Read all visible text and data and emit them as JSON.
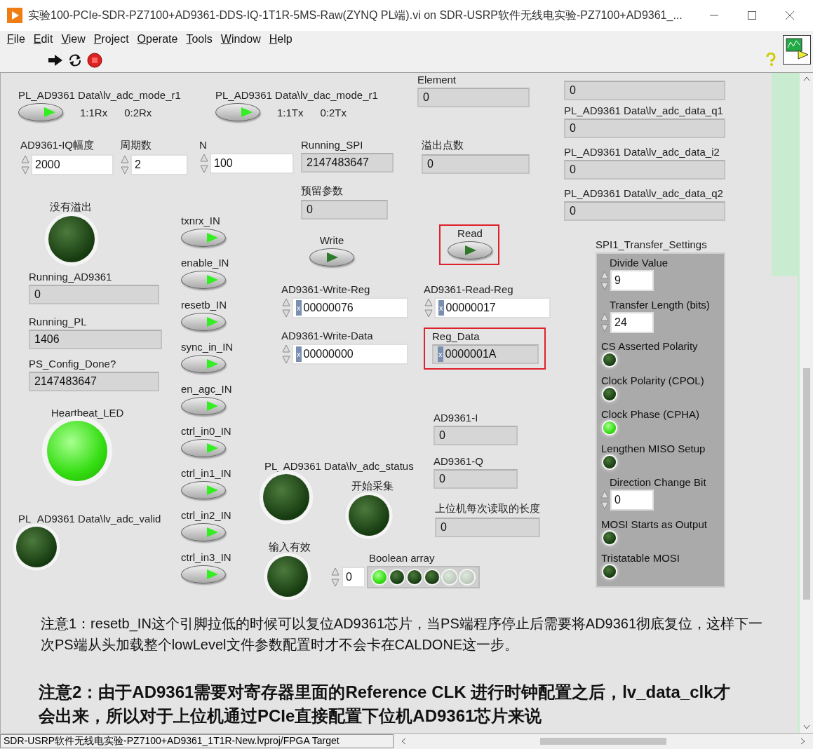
{
  "window": {
    "title": "实验100-PCIe-SDR-PZ7100+AD9361-DDS-IQ-1T1R-5MS-Raw(ZYNQ PL端).vi on SDR-USRP软件无线电实验-PZ7100+AD9361_...",
    "status_path": "SDR-USRP软件无线电实验-PZ7100+AD9361_1T1R-New.lvproj/FPGA Target"
  },
  "menu": [
    "File",
    "Edit",
    "View",
    "Project",
    "Operate",
    "Tools",
    "Window",
    "Help"
  ],
  "panel": {
    "items": [
      {
        "kind": "switch",
        "label": "PL_AD9361 Data\\lv_adc_mode_r1",
        "on": true,
        "highlighted": false,
        "options": [
          "1:1Rx",
          "0:2Rx"
        ]
      },
      {
        "kind": "switch",
        "label": "PL_AD9361 Data\\lv_dac_mode_r1",
        "on": true,
        "highlighted": false,
        "options": [
          "1:1Tx",
          "0:2Tx"
        ]
      },
      {
        "kind": "indicator",
        "label": "Element",
        "value": "0",
        "highlighted": false
      },
      {
        "kind": "indicator",
        "value": "0",
        "highlighted": false
      },
      {
        "kind": "indicator",
        "label": "PL_AD9361 Data\\lv_adc_data_q1",
        "value": "0",
        "highlighted": false
      },
      {
        "kind": "indicator",
        "label": "PL_AD9361 Data\\lv_adc_data_i2",
        "value": "0",
        "highlighted": false
      },
      {
        "kind": "indicator",
        "label": "PL_AD9361 Data\\lv_adc_data_q2",
        "value": "0",
        "highlighted": false
      },
      {
        "kind": "numeric",
        "label": "AD9361-IQ幅度",
        "value": "2000",
        "highlighted": false
      },
      {
        "kind": "numeric",
        "label": "周期数",
        "value": "2",
        "highlighted": false
      },
      {
        "kind": "numeric",
        "label": "N",
        "value": "100",
        "highlighted": false
      },
      {
        "kind": "indicator",
        "label": "Running_SPI",
        "value": "2147483647",
        "highlighted": false
      },
      {
        "kind": "indicator",
        "label": "溢出点数",
        "value": "0",
        "highlighted": false
      },
      {
        "kind": "led",
        "label": "没有溢出",
        "on": false,
        "highlighted": false
      },
      {
        "kind": "indicator",
        "label": "预留参数",
        "value": "0",
        "highlighted": false
      },
      {
        "kind": "switch",
        "label": "txnrx_IN",
        "on": true,
        "highlighted": false
      },
      {
        "kind": "switch",
        "label": "enable_IN",
        "on": true,
        "highlighted": false
      },
      {
        "kind": "switch",
        "label": "resetb_IN",
        "on": true,
        "highlighted": false
      },
      {
        "kind": "switch",
        "label": "sync_in_IN",
        "on": true,
        "highlighted": false
      },
      {
        "kind": "switch",
        "label": "en_agc_IN",
        "on": true,
        "highlighted": false
      },
      {
        "kind": "switch",
        "label": "ctrl_in0_IN",
        "on": true,
        "highlighted": false
      },
      {
        "kind": "switch",
        "label": "ctrl_in1_IN",
        "on": true,
        "highlighted": false
      },
      {
        "kind": "switch",
        "label": "ctrl_in2_IN",
        "on": true,
        "highlighted": false
      },
      {
        "kind": "switch",
        "label": "ctrl_in3_IN",
        "on": true,
        "highlighted": false
      },
      {
        "kind": "switch",
        "label": "Write",
        "on": false,
        "highlighted": false
      },
      {
        "kind": "switch",
        "label": "Read",
        "on": false,
        "highlighted": true
      },
      {
        "kind": "indicator",
        "label": "Running_AD9361",
        "value": "0",
        "highlighted": false
      },
      {
        "kind": "indicator",
        "label": "Running_PL",
        "value": "1406",
        "highlighted": false
      },
      {
        "kind": "indicator",
        "label": "PS_Config_Done?",
        "value": "2147483647",
        "highlighted": false
      },
      {
        "kind": "numeric",
        "label": "AD9361-Write-Reg",
        "radix": "x",
        "value": "00000076",
        "highlighted": false
      },
      {
        "kind": "numeric",
        "label": "AD9361-Read-Reg",
        "radix": "x",
        "value": "00000017",
        "highlighted": false
      },
      {
        "kind": "numeric",
        "label": "AD9361-Write-Data",
        "radix": "x",
        "value": "00000000",
        "highlighted": false
      },
      {
        "kind": "indicator",
        "label": "Reg_Data",
        "radix": "x",
        "value": "0000001A",
        "highlighted": true
      },
      {
        "kind": "led",
        "label": "Heartbeat_LED",
        "on": true,
        "highlighted": false
      },
      {
        "kind": "indicator",
        "label": "AD9361-I",
        "value": "0",
        "highlighted": false
      },
      {
        "kind": "led",
        "label": "PL_AD9361 Data\\lv_adc_status",
        "on": false,
        "highlighted": false
      },
      {
        "kind": "indicator",
        "label": "AD9361-Q",
        "value": "0",
        "highlighted": false
      },
      {
        "kind": "led",
        "label": "开始采集",
        "on": false,
        "highlighted": false
      },
      {
        "kind": "led",
        "label": "PL_AD9361 Data\\lv_adc_valid",
        "on": false,
        "highlighted": false
      },
      {
        "kind": "indicator",
        "label": "上位机每次读取的长度",
        "value": "0",
        "highlighted": false
      },
      {
        "kind": "led",
        "label": "输入有效",
        "on": false,
        "highlighted": false
      }
    ]
  },
  "boolean_array": {
    "label": "Boolean array",
    "index": "0",
    "items": [
      {
        "on": true,
        "greyed": false
      },
      {
        "on": false,
        "greyed": false
      },
      {
        "on": false,
        "greyed": false
      },
      {
        "on": false,
        "greyed": false
      },
      {
        "on": false,
        "greyed": true
      },
      {
        "on": false,
        "greyed": true
      }
    ]
  },
  "spi": {
    "label": "SPI1_Transfer_Settings",
    "items": [
      {
        "kind": "numeric",
        "label": "Divide Value",
        "value": "9"
      },
      {
        "kind": "numeric",
        "label": "Transfer Length (bits)",
        "value": "24"
      },
      {
        "kind": "led",
        "label": "CS Asserted Polarity",
        "on": false
      },
      {
        "kind": "led",
        "label": "Clock Polarity (CPOL)",
        "on": false
      },
      {
        "kind": "led",
        "label": "Clock Phase (CPHA)",
        "on": true
      },
      {
        "kind": "led",
        "label": "Lengthen MISO Setup",
        "on": false
      },
      {
        "kind": "numeric",
        "label": "Direction Change Bit",
        "value": "0"
      },
      {
        "kind": "led",
        "label": "MOSI Starts as Output",
        "on": false
      },
      {
        "kind": "led",
        "label": "Tristatable MOSI",
        "on": false
      }
    ]
  },
  "notes": [
    {
      "kind": "normal",
      "text": "注意1：resetb_IN这个引脚拉低的时候可以复位AD9361芯片，当PS端程序停止后需要将AD9361彻底复位，这样下一次PS端从头加载整个lowLevel文件参数配置时才不会卡在CALDONE这一步。"
    },
    {
      "kind": "emphasis",
      "text": "注意2：由于AD9361需要对寄存器里面的Reference CLK 进行时钟配置之后，lv_data_clk才会出来，所以对于上位机通过PCIe直接配置下位机AD9361芯片来说"
    }
  ]
}
